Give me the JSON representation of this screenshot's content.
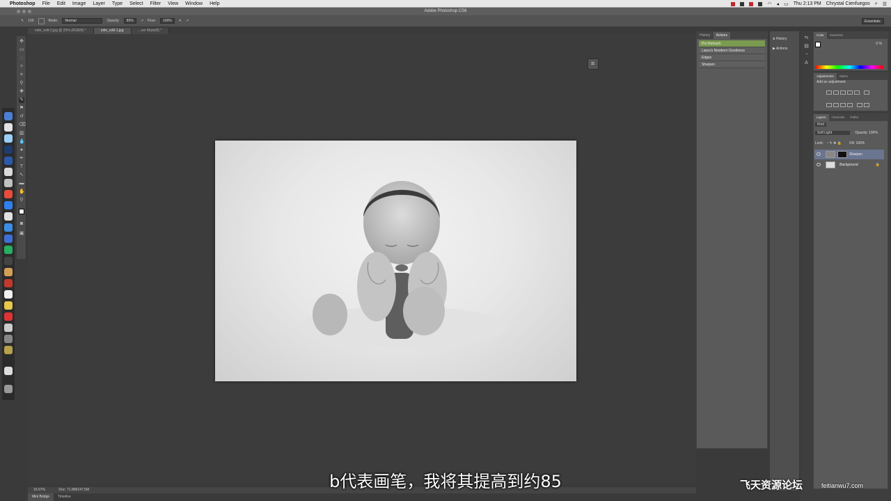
{
  "menubar": {
    "app": "Photoshop",
    "items": [
      "File",
      "Edit",
      "Image",
      "Layer",
      "Type",
      "Select",
      "Filter",
      "View",
      "Window",
      "Help"
    ],
    "time": "Thu 2:13 PM",
    "user": "Chrystal Cienfuegos"
  },
  "window": {
    "title": "Adobe Photoshop CS6"
  },
  "options": {
    "brush_size": "100",
    "mode_label": "Mode:",
    "mode_value": "Normal",
    "opacity_label": "Opacity:",
    "opacity_value": "85%",
    "flow_label": "Flow:",
    "flow_value": "100%",
    "workspace": "Essentials"
  },
  "tabs": [
    "edie_edit-2.jpg @ 25% (RGB/8) *",
    "edie_edit-1.jpg",
    "...ver Mask/8) *"
  ],
  "statusbar": {
    "zoom": "16.67%",
    "doc": "Doc: 71.8M/147.5M"
  },
  "bottom_tabs": [
    "Mini Bridge",
    "Timeline"
  ],
  "actions_panel": {
    "tabs": [
      "History",
      "Actions"
    ],
    "items": [
      "Pro Retouch",
      "Laura's Newborn Goodness",
      "Edges",
      "Sharpen"
    ],
    "selected_index": 0
  },
  "collapsed_panels": [
    "History",
    "Actions"
  ],
  "color_panel": {
    "tabs": [
      "Color",
      "Swatches"
    ],
    "k_value": "0",
    "k_unit": "%"
  },
  "adjustments_panel": {
    "tabs": [
      "Adjustments",
      "Styles"
    ],
    "title": "Add an adjustment"
  },
  "layers_panel": {
    "tabs": [
      "Layers",
      "Channels",
      "Paths"
    ],
    "filter": "Kind",
    "blend": "Soft Light",
    "opacity_label": "Opacity:",
    "opacity": "100%",
    "lock_label": "Lock:",
    "fill_label": "Fill:",
    "fill": "100%",
    "layers": [
      "Sharpen",
      "Background"
    ]
  },
  "subtitle": "b代表画笔，我将其提高到约85",
  "watermark": {
    "brand": "飞天资源论坛",
    "url": "feitianwu7.com"
  },
  "colors": {
    "action_selected": "#7a9a4f",
    "layer_selected": "#6a7590"
  }
}
